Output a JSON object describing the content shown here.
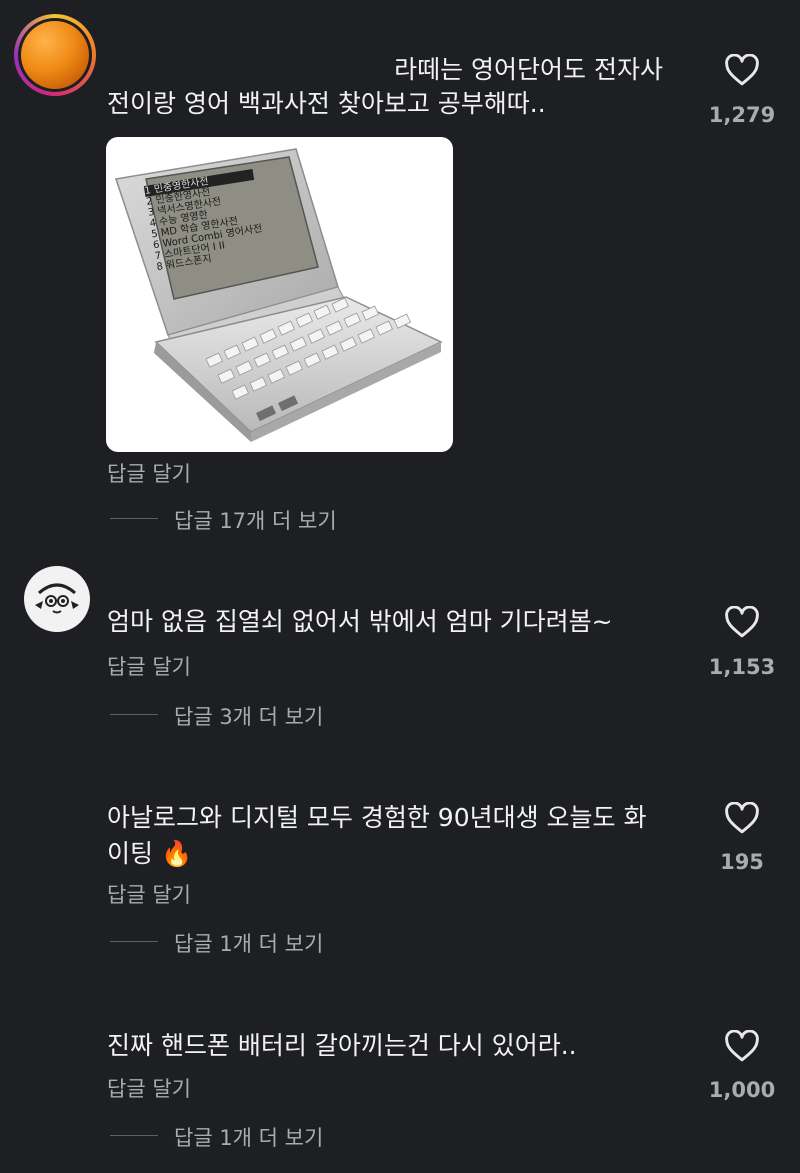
{
  "comments": [
    {
      "text_line1": "라떼는 영어단어도 전자사",
      "text_line2": "전이랑 영어 백과사전 찾아보고 공부해따..",
      "reply_label": "답글 달기",
      "more_replies": "답글 17개 더 보기",
      "likes": "1,279",
      "avatar": "orange-avatar",
      "dictionary_menu": [
        "1 민중영한사전",
        "2 민중한영사전",
        "3 넥서스영한사전",
        "4 수능 영영한",
        "5 MD 학습 영한사전",
        "6 Word Combi 영어사전",
        "7 스마트단어 I II",
        "8 워드스폰지"
      ]
    },
    {
      "text": "엄마 없음 집열쇠 없어서 밖에서 엄마 기다려봄~",
      "reply_label": "답글 달기",
      "more_replies": "답글 3개 더 보기",
      "likes": "1,153",
      "avatar": "cartoon-face-avatar"
    },
    {
      "text_line1": "아날로그와 디지털 모두 경험한 90년대생 오늘도 화",
      "text_line2": "이팅 🔥",
      "reply_label": "답글 달기",
      "more_replies": "답글 1개 더 보기",
      "likes": "195"
    },
    {
      "text": "진짜 핸드폰 배터리 갈아끼는건 다시 있어라..",
      "reply_label": "답글 달기",
      "more_replies": "답글 1개 더 보기",
      "likes": "1,000"
    }
  ],
  "icons": {
    "like": "heart-outline-icon"
  },
  "colors": {
    "background": "#1e1f22",
    "text_primary": "#f2f2f2",
    "text_secondary": "#a9abb0"
  }
}
